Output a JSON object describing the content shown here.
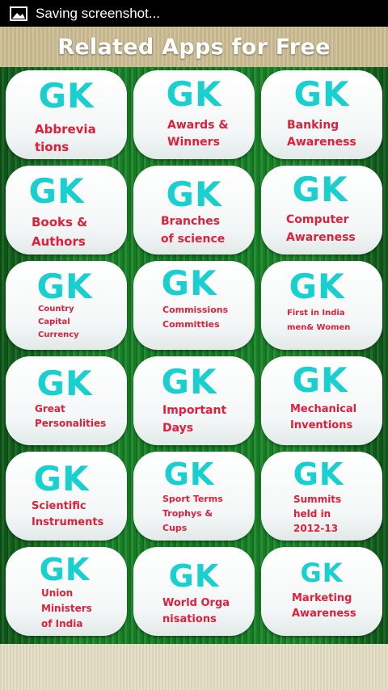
{
  "status_bar": {
    "text": "Saving screenshot...",
    "icon": "image-icon"
  },
  "header": {
    "title": "Related Apps for Free"
  },
  "tiles": [
    {
      "badge": "GK",
      "label": "Abbrevia\ntions"
    },
    {
      "badge": "GK",
      "label": "Awards &\nWinners"
    },
    {
      "badge": "GK",
      "label": "Banking\nAwareness"
    },
    {
      "badge": "GK",
      "label": "Books &\nAuthors"
    },
    {
      "badge": "GK",
      "label": "Branches\nof science"
    },
    {
      "badge": "GK",
      "label": "Computer\nAwareness"
    },
    {
      "badge": "GK",
      "label": "Country\nCapital\nCurrency"
    },
    {
      "badge": "GK",
      "label": "Commissions\nCommitties"
    },
    {
      "badge": "GK",
      "label": "First in India\nmen& Women"
    },
    {
      "badge": "GK",
      "label": "Great\nPersonalities"
    },
    {
      "badge": "GK",
      "label": "Important\nDays"
    },
    {
      "badge": "GK",
      "label": "Mechanical\nInventions"
    },
    {
      "badge": "GK",
      "label": "Scientific\nInstruments"
    },
    {
      "badge": "GK",
      "label": "Sport Terms\nTrophys &\nCups"
    },
    {
      "badge": "GK",
      "label": "Summits\nheld in\n2012-13"
    },
    {
      "badge": "GK",
      "label": "Union\nMinisters\nof India"
    },
    {
      "badge": "GK",
      "label": "World Orga\nnisations"
    },
    {
      "badge": "GK",
      "label": "Marketing\nAwareness"
    }
  ],
  "colors": {
    "badge": "#18d0d0",
    "label": "#e0203a",
    "background": "#138023"
  }
}
